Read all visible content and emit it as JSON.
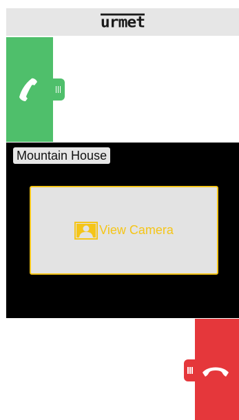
{
  "header": {
    "brand": "urmet"
  },
  "answer_slider": {
    "icon": "phone-answer-icon",
    "color": "#4fbf6b"
  },
  "video": {
    "device_label": "Mountain House",
    "camera_button": {
      "label": "View Camera",
      "icon": "camera-person-icon",
      "accent": "#f5c518"
    }
  },
  "hangup_slider": {
    "icon": "phone-hangup-icon",
    "color": "#e5373b"
  }
}
